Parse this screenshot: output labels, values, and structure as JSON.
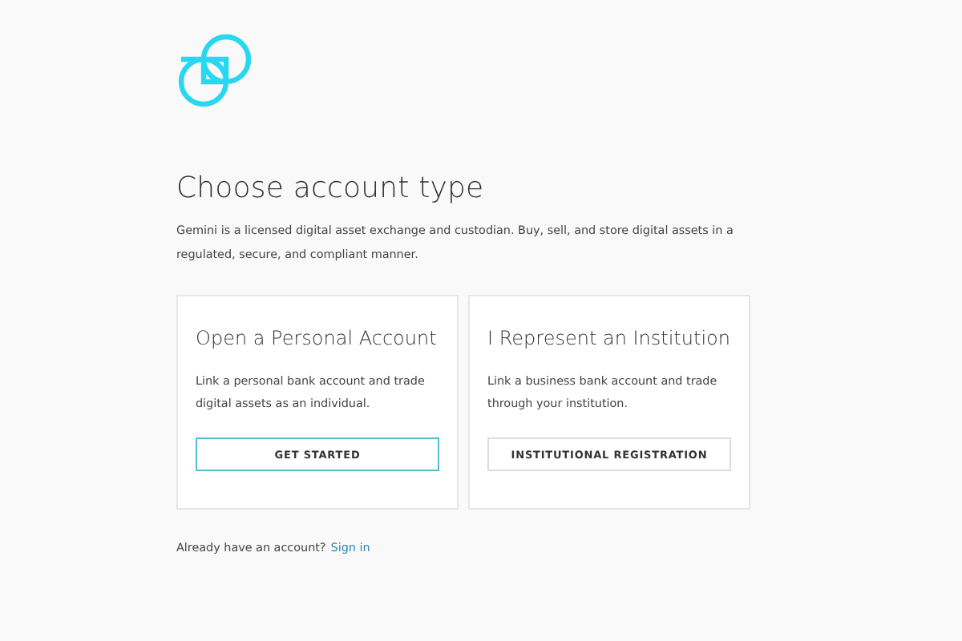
{
  "heading": "Choose account type",
  "intro": "Gemini is a licensed digital asset exchange and custodian. Buy, sell, and store digital assets in a regulated, secure, and compliant manner.",
  "cards": [
    {
      "title": "Open a Personal Account",
      "description": "Link a personal bank account and trade digital assets as an individual.",
      "button": "GET STARTED",
      "primary": true
    },
    {
      "title": "I Represent an Institution",
      "description": "Link a business bank account and trade through your institution.",
      "button": "INSTITUTIONAL REGISTRATION",
      "primary": false
    }
  ],
  "footer": {
    "text": "Already have an account?",
    "link": "Sign in"
  }
}
